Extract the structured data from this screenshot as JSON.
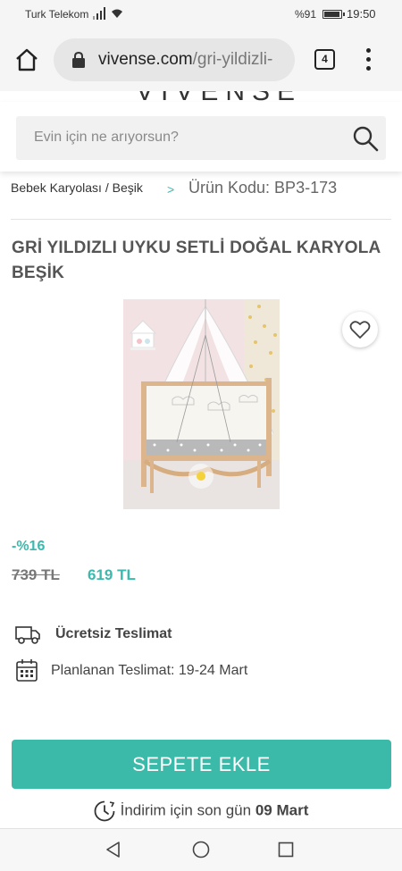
{
  "status": {
    "carrier": "Turk Telekom",
    "battery": "%91",
    "time": "19:50"
  },
  "browser": {
    "url_domain": "vivense.com",
    "url_path": "/gri-yildizli-",
    "tab_count": "4"
  },
  "site": {
    "logo": "VIVENSE",
    "search_placeholder": "Evin için ne arıyorsun?"
  },
  "breadcrumb": {
    "category": "Bebek Karyolası / Beşik",
    "separator": ">",
    "product_code": "Ürün Kodu: BP3-173"
  },
  "product": {
    "title": "GRİ YILDIZLI UYKU SETLİ DOĞAL KARYOLA BEŞİK",
    "discount": "-%16",
    "old_price": "739 TL",
    "new_price": "619 TL",
    "free_shipping": "Ücretsiz Teslimat",
    "planned_delivery": "Planlanan Teslimat: 19-24 Mart"
  },
  "cart": {
    "add_label": "SEPETE EKLE"
  },
  "countdown": {
    "text": "İndirim için son gün",
    "date": "09 Mart"
  },
  "colors": {
    "accent": "#3bbaa9",
    "text": "#444444",
    "background": "#ffffff"
  },
  "icons": {
    "home": "home-icon",
    "lock": "lock-icon",
    "menu": "more-vert-icon",
    "search": "search-icon",
    "favorite": "heart-icon",
    "truck": "truck-icon",
    "calendar": "calendar-icon",
    "clock": "clock-icon"
  }
}
